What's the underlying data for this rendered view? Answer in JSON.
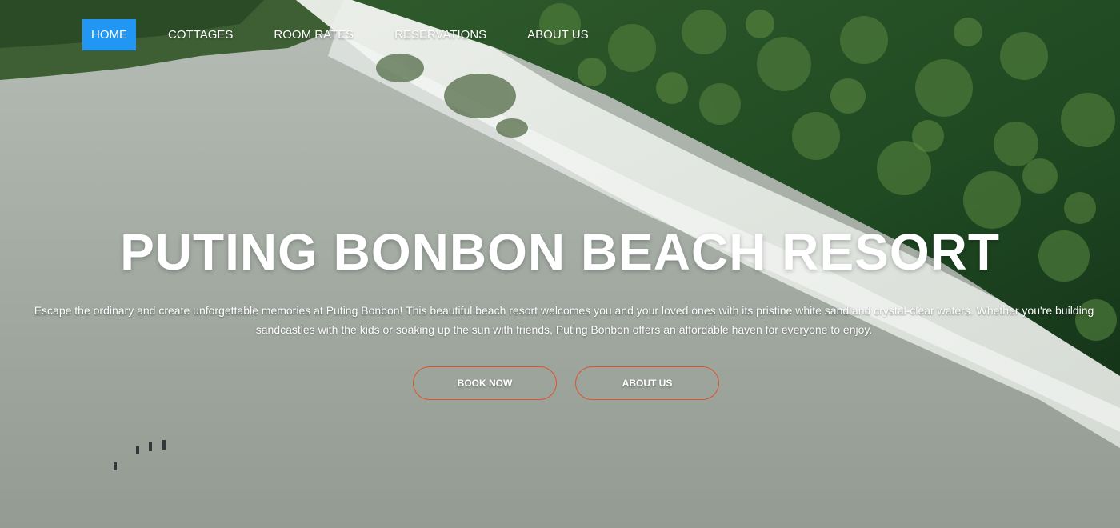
{
  "nav": {
    "items": [
      {
        "label": "HOME",
        "active": true
      },
      {
        "label": "COTTAGES",
        "active": false
      },
      {
        "label": "ROOM RATES",
        "active": false
      },
      {
        "label": "RESERVATIONS",
        "active": false
      },
      {
        "label": "ABOUT US",
        "active": false
      }
    ]
  },
  "hero": {
    "title": "PUTING BONBON BEACH RESORT",
    "description": "Escape the ordinary and create unforgettable memories at Puting Bonbon! This beautiful beach resort welcomes you and your loved ones with its pristine white sand and crystal-clear waters. Whether you're building sandcastles with the kids or soaking up the sun with friends, Puting Bonbon offers an affordable haven for everyone to enjoy.",
    "buttons": {
      "book_now": "BOOK NOW",
      "about_us": "ABOUT US"
    }
  },
  "colors": {
    "nav_active_bg": "#2196f3",
    "button_border": "#e0522a",
    "text": "#ffffff"
  }
}
